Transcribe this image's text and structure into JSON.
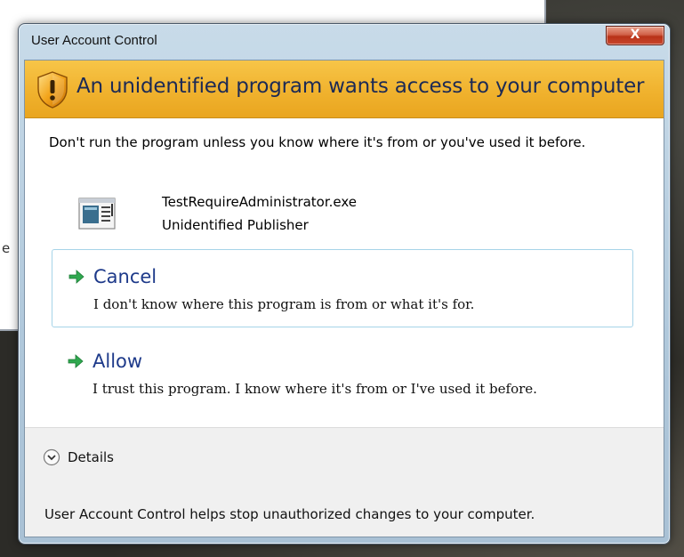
{
  "background": {
    "edge_glyph": "e"
  },
  "dialog": {
    "title": "User Account Control",
    "close_label": "X",
    "banner": {
      "icon": "shield-warning-icon",
      "headline": "An unidentified program wants access to your computer",
      "color": "#f0b22e"
    },
    "warning_text": "Don't run the program unless you know where it's from or you've used it before.",
    "program": {
      "icon": "executable-file-icon",
      "name": "TestRequireAdministrator.exe",
      "publisher": "Unidentified Publisher"
    },
    "options": [
      {
        "title": "Cancel",
        "description": "I don't know where this program is from or what it's for.",
        "focused": true
      },
      {
        "title": "Allow",
        "description": "I trust this program. I know where it's from or I've used it before.",
        "focused": false
      }
    ],
    "details_label": "Details",
    "footer_text": "User Account Control helps stop unauthorized changes to your computer.",
    "accent_color": "#1e3a8a",
    "arrow_color": "#2fa84f"
  }
}
